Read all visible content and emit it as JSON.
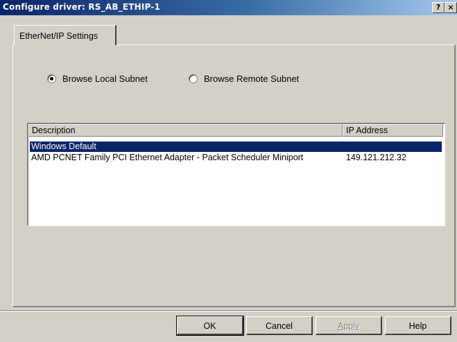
{
  "window": {
    "title": "Configure driver: RS_AB_ETHIP-1",
    "help_glyph": "?",
    "close_glyph": "×"
  },
  "tabs": [
    {
      "label": "EtherNet/IP Settings"
    }
  ],
  "browse": {
    "options": [
      {
        "label": "Browse Local Subnet",
        "selected": true
      },
      {
        "label": "Browse Remote Subnet",
        "selected": false
      }
    ]
  },
  "table": {
    "columns": [
      "Description",
      "IP Address"
    ],
    "rows": [
      {
        "description": "Windows Default",
        "ip": "",
        "selected": true
      },
      {
        "description": "AMD PCNET Family PCI Ethernet Adapter - Packet Scheduler Miniport",
        "ip": "149.121.212.32",
        "selected": false
      }
    ]
  },
  "buttons": {
    "ok": "OK",
    "cancel": "Cancel",
    "apply": "Apply",
    "help": "Help"
  },
  "colors": {
    "selection": "#0a246a",
    "face": "#d4d0c8"
  }
}
